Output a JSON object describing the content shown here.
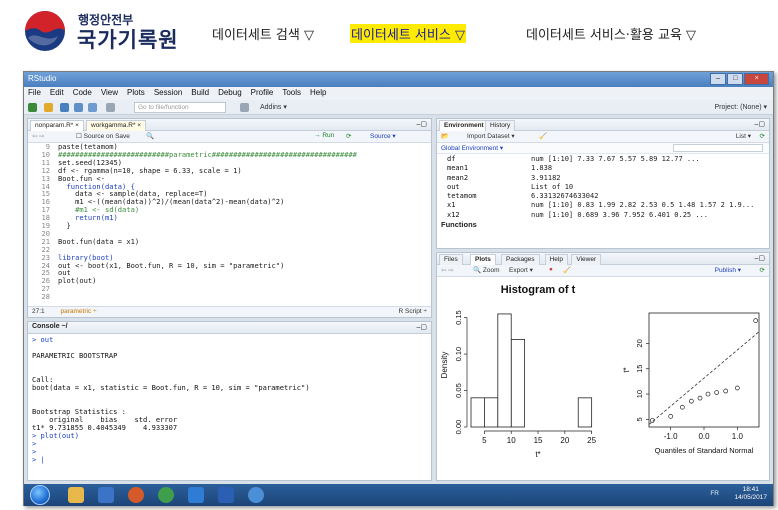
{
  "site_header": {
    "logo_line1": "행정안전부",
    "logo_line2": "국가기록원",
    "nav": [
      {
        "label": "데이터세트 검색 ▽"
      },
      {
        "label": "데이터세트 서비스 ▽",
        "active": true,
        "highlight_color": "#ffeb00"
      },
      {
        "label": "데이터세트 서비스·활용 교육 ▽"
      }
    ]
  },
  "rstudio": {
    "window_title": "RStudio",
    "menu": [
      "File",
      "Edit",
      "Code",
      "View",
      "Plots",
      "Session",
      "Build",
      "Debug",
      "Profile",
      "Tools",
      "Help"
    ],
    "toolbar": {
      "goto_placeholder": "Go to file/function",
      "addins": "Addins ▾",
      "project": "Project: (None) ▾"
    },
    "editor": {
      "tabs": [
        "nonparam.R* ×",
        "workgamma.R* ×"
      ],
      "source_on_save": "Source on Save",
      "run": "Run",
      "source": "Source ▾",
      "lines": [
        {
          "n": "9",
          "t": "paste(tetamom)"
        },
        {
          "n": "10",
          "t": "##########################parametric##################################"
        },
        {
          "n": "11",
          "t": "set.seed(12345)"
        },
        {
          "n": "12",
          "t": "df <- rgamma(n=10, shape = 6.33, scale = 1)"
        },
        {
          "n": "13",
          "t": "Boot.fun <-"
        },
        {
          "n": "14",
          "t": "  function(data) {"
        },
        {
          "n": "15",
          "t": "    data <- sample(data, replace=T)"
        },
        {
          "n": "16",
          "t": "    m1 <-((mean(data))^2)/(mean(data^2)-mean(data)^2)"
        },
        {
          "n": "17",
          "t": "    #m1 <- sd(data)"
        },
        {
          "n": "18",
          "t": "    return(m1)"
        },
        {
          "n": "19",
          "t": "  }"
        },
        {
          "n": "20",
          "t": ""
        },
        {
          "n": "21",
          "t": "Boot.fun(data = x1)"
        },
        {
          "n": "22",
          "t": ""
        },
        {
          "n": "23",
          "t": "library(boot)"
        },
        {
          "n": "24",
          "t": "out <- boot(x1, Boot.fun, R = 10, sim = \"parametric\")"
        },
        {
          "n": "25",
          "t": "out"
        },
        {
          "n": "26",
          "t": "plot(out)"
        },
        {
          "n": "27",
          "t": ""
        },
        {
          "n": "28",
          "t": ""
        }
      ],
      "status_pos": "27:1",
      "status_scope": "parametric ÷",
      "status_type": "R Script ÷"
    },
    "console": {
      "title": "Console ~/",
      "lines": [
        {
          "t": "> out",
          "cls": "blue"
        },
        {
          "t": ""
        },
        {
          "t": "PARAMETRIC BOOTSTRAP"
        },
        {
          "t": ""
        },
        {
          "t": ""
        },
        {
          "t": "Call:"
        },
        {
          "t": "boot(data = x1, statistic = Boot.fun, R = 10, sim = \"parametric\")"
        },
        {
          "t": ""
        },
        {
          "t": ""
        },
        {
          "t": "Bootstrap Statistics :"
        },
        {
          "t": "    original    bias    std. error"
        },
        {
          "t": "t1* 9.731855 0.4045349    4.933307"
        },
        {
          "t": "> plot(out)",
          "cls": "blue"
        },
        {
          "t": ">",
          "cls": "blue"
        },
        {
          "t": ">",
          "cls": "blue"
        },
        {
          "t": "> |",
          "cls": "blue"
        }
      ]
    },
    "environment": {
      "tabs": [
        "Environment",
        "History"
      ],
      "import": "Import Dataset ▾",
      "list_view": "List ▾",
      "scope": "Global Environment ▾",
      "rows": [
        {
          "name": "df",
          "value": "num [1:10] 7.33 7.67 5.57 5.89 12.77 ..."
        },
        {
          "name": "mean1",
          "value": "1.838"
        },
        {
          "name": "mean2",
          "value": "3.91182"
        },
        {
          "name": "out",
          "value": "List of 10"
        },
        {
          "name": "tetamom",
          "value": "6.33132674633042"
        },
        {
          "name": "x1",
          "value": "num [1:10] 0.83 1.99 2.82 2.53 0.5 1.48 1.57 2 1.9..."
        },
        {
          "name": "x12",
          "value": "num [1:10] 0.689 3.96 7.952 6.401 0.25 ..."
        }
      ],
      "section": "Functions"
    },
    "plots": {
      "tabs": [
        "Files",
        "Plots",
        "Packages",
        "Help",
        "Viewer"
      ],
      "zoom": "Zoom",
      "export": "Export ▾",
      "publish": "Publish ▾"
    },
    "taskbar": {
      "lang": "FR",
      "time": "18:41",
      "date": "14/05/2017"
    }
  },
  "chart_data": [
    {
      "type": "histogram",
      "title": "Histogram of t",
      "xlabel": "t*",
      "ylabel": "Density",
      "bins": [
        [
          2.5,
          5
        ],
        [
          5,
          7.5
        ],
        [
          10,
          12.5
        ],
        [
          7.5,
          10
        ],
        [
          22.5,
          25
        ]
      ],
      "bar_edges": [
        2.5,
        5,
        7.5,
        10,
        12.5,
        22.5,
        25
      ],
      "densities": [
        0.04,
        0.04,
        0.12,
        0.155,
        0.04
      ],
      "xticks": [
        "5",
        "10",
        "15",
        "20",
        "25"
      ],
      "yticks": [
        "0.00",
        "0.05",
        "0.10",
        "0.15"
      ],
      "xlim": [
        2.5,
        26
      ],
      "ylim": [
        0,
        0.17
      ]
    },
    {
      "type": "scatter",
      "title": "",
      "xlabel": "Quantiles of Standard Normal",
      "ylabel": "t*",
      "xticks": [
        "-1.0",
        "0.0",
        "1.0"
      ],
      "yticks": [
        "5",
        "10",
        "15",
        "20"
      ],
      "xlim": [
        -1.65,
        1.65
      ],
      "ylim": [
        3.5,
        26
      ],
      "points": [
        {
          "x": -1.55,
          "y": 4.8
        },
        {
          "x": -1.0,
          "y": 5.6
        },
        {
          "x": -0.65,
          "y": 7.4
        },
        {
          "x": -0.38,
          "y": 8.6
        },
        {
          "x": -0.12,
          "y": 9.2
        },
        {
          "x": 0.12,
          "y": 10.0
        },
        {
          "x": 0.38,
          "y": 10.3
        },
        {
          "x": 0.65,
          "y": 10.6
        },
        {
          "x": 1.0,
          "y": 11.2
        },
        {
          "x": 1.55,
          "y": 24.5
        }
      ],
      "reference_line": {
        "x1": -1.65,
        "y1": 4.0,
        "x2": 1.65,
        "y2": 22.3
      }
    }
  ]
}
